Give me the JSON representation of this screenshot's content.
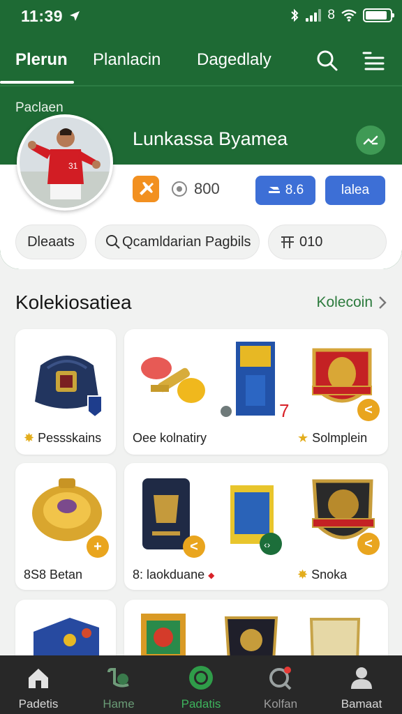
{
  "status_bar": {
    "time": "11:39",
    "network": "8"
  },
  "header": {
    "tabs": [
      {
        "label": "Plerun",
        "active": true
      },
      {
        "label": "Planlacin",
        "active": false
      },
      {
        "label": "Dagedlaly",
        "active": false
      }
    ]
  },
  "profile": {
    "section_label": "Paclaen",
    "name": "Lunkassa Byamea",
    "coins": "800",
    "action_button_label": "8.6",
    "secondary_button_label": "lalea",
    "chips": [
      {
        "label": "Dleaats"
      },
      {
        "label": "Qcamldarian Pagbils"
      },
      {
        "label": "010"
      }
    ]
  },
  "collection": {
    "title": "Kolekiosatiea",
    "link_label": "Kolecoin",
    "cards": [
      {
        "label": "Pessskains"
      },
      {
        "label": "Oee kolnatiry"
      },
      {
        "label": "Solmplein"
      },
      {
        "label": "Betan",
        "prefix": "8S8"
      },
      {
        "label": "laokduane",
        "prefix": "8:"
      },
      {
        "label": "Snoka"
      }
    ]
  },
  "bottom_nav": {
    "items": [
      {
        "label": "Padetis",
        "icon": "home-icon"
      },
      {
        "label": "Hame",
        "icon": "controller-icon"
      },
      {
        "label": "Padatis",
        "icon": "ring-icon",
        "active": true
      },
      {
        "label": "Kolfan",
        "icon": "search-notification-icon"
      },
      {
        "label": "Bamaat",
        "icon": "profile-icon"
      }
    ]
  },
  "colors": {
    "primary_green": "#1e6a34",
    "accent_blue": "#3d6fd6",
    "accent_orange": "#f29020",
    "nav_bg": "#282828"
  }
}
